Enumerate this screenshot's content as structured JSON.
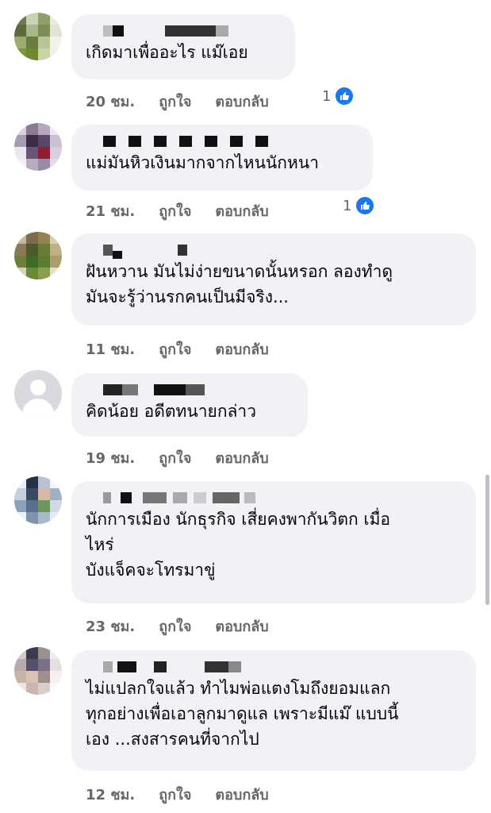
{
  "comments": [
    {
      "text": "เกิดมาเพื่ออะไร แม๊เอย",
      "time": "20 ชม.",
      "like": "ถูกใจ",
      "reply": "ตอบกลับ",
      "reactions": "1"
    },
    {
      "text": "แม่มันหิวเงินมากจากไหนนักหนา",
      "time": "21 ชม.",
      "like": "ถูกใจ",
      "reply": "ตอบกลับ",
      "reactions": "1"
    },
    {
      "text": "ฝันหวาน มันไม่ง่ายขนาดนั้นหรอก ลองทำดู\nมันจะรู้ว่านรกคนเป็นมีจริง...",
      "time": "11 ชม.",
      "like": "ถูกใจ",
      "reply": "ตอบกลับ"
    },
    {
      "text": "คิดน้อย อดีตทนายกล่าว",
      "time": "19 ชม.",
      "like": "ถูกใจ",
      "reply": "ตอบกลับ"
    },
    {
      "text": "นักการเมือง นักธุรกิจ เสี่ยคงพากันวิตก เมื่อ\nไหร่\nบังแจ็คจะโทรมาขู่",
      "time": "23 ชม.",
      "like": "ถูกใจ",
      "reply": "ตอบกลับ"
    },
    {
      "text": "ไม่แปลกใจแล้ว ทำไมพ่อแตงโมถึงยอมแลก\nทุกอย่างเพื่อเอาลูกมาดูแล เพราะมีแม๊ แบบนี้\nเอง ...สงสารคนที่จากไป",
      "time": "12 ชม.",
      "like": "ถูกใจ",
      "reply": "ตอบกลับ"
    }
  ],
  "icons": {
    "like": "thumbs-up-icon"
  },
  "colors": {
    "bubble": "#f0f2f5",
    "meta": "#65676b",
    "like_blue": "#1877f2"
  }
}
